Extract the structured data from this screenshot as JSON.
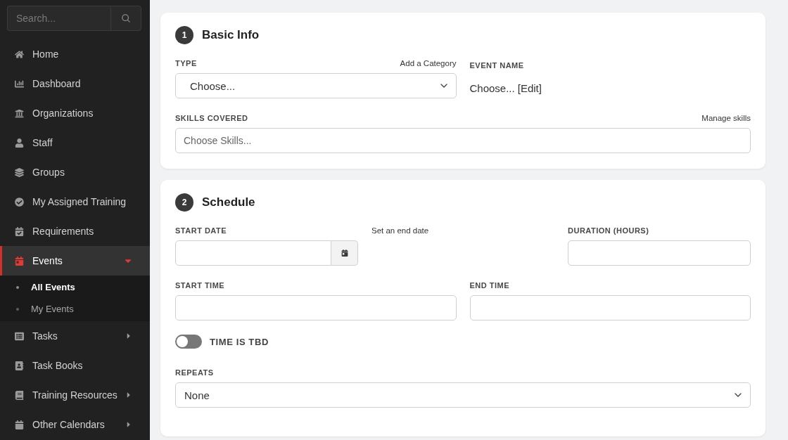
{
  "sidebar": {
    "search": {
      "placeholder": "Search..."
    },
    "items": [
      {
        "kind": "link",
        "label": "Home",
        "selected": false
      },
      {
        "kind": "link",
        "label": "Dashboard",
        "selected": false
      },
      {
        "kind": "link",
        "label": "Organizations",
        "selected": false
      },
      {
        "kind": "link",
        "label": "Staff",
        "selected": false
      },
      {
        "kind": "link",
        "label": "Groups",
        "selected": false
      },
      {
        "kind": "link",
        "label": "My Assigned Training",
        "selected": false
      },
      {
        "kind": "link",
        "label": "Requirements",
        "selected": false
      },
      {
        "kind": "group",
        "label": "Events",
        "selected": true,
        "expanded": true,
        "children": [
          {
            "label": "All Events",
            "selected": true
          },
          {
            "label": "My Events",
            "selected": false
          }
        ]
      },
      {
        "kind": "group",
        "label": "Tasks",
        "selected": false,
        "expanded": false
      },
      {
        "kind": "link",
        "label": "Task Books",
        "selected": false
      },
      {
        "kind": "group",
        "label": "Training Resources",
        "selected": false,
        "expanded": false
      },
      {
        "kind": "group",
        "label": "Other Calendars",
        "selected": false,
        "expanded": false
      }
    ]
  },
  "basic_info": {
    "number": "1",
    "title": "Basic Info",
    "type": {
      "label": "TYPE",
      "link": "Add a Category",
      "value": "Choose..."
    },
    "event_name": {
      "label": "EVENT NAME",
      "value": "Choose...",
      "edit_link": "[Edit]"
    },
    "skills": {
      "label": "SKILLS COVERED",
      "link": "Manage skills",
      "placeholder": "Choose Skills..."
    }
  },
  "schedule": {
    "number": "2",
    "title": "Schedule",
    "start_date": {
      "label": "START DATE"
    },
    "end_date_link": "Set an end date",
    "duration": {
      "label": "DURATION (HOURS)"
    },
    "start_time": {
      "label": "START TIME"
    },
    "end_time": {
      "label": "END TIME"
    },
    "tbd": {
      "label": "TIME IS TBD",
      "on": false
    },
    "repeats": {
      "label": "REPEATS",
      "value": "None"
    }
  }
}
